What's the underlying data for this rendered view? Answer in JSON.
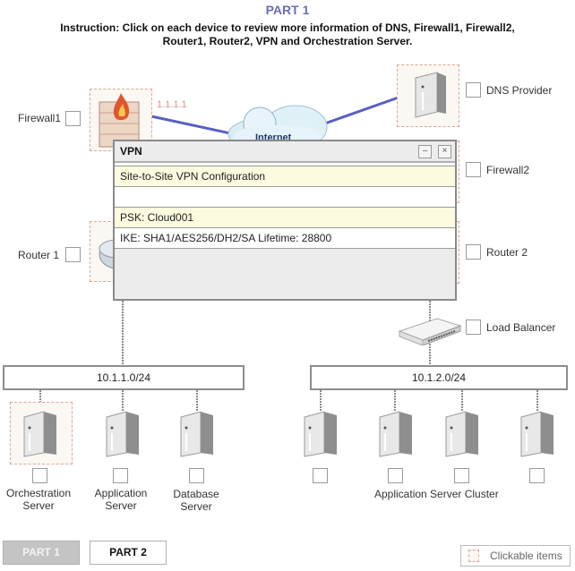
{
  "header": {
    "title": "PART 1",
    "instruction": "Instruction: Click on each device to review more information of DNS, Firewall1, Firewall2, Router1, Router2, VPN and Orchestration Server."
  },
  "devices": {
    "firewall1": {
      "label": "Firewall1",
      "ip": "1.1.1.1"
    },
    "dns": {
      "label": "DNS Provider"
    },
    "internet": {
      "label": "Internet"
    },
    "firewall2": {
      "label": "Firewall2"
    },
    "router1": {
      "label": "Router 1"
    },
    "router2": {
      "label": "Router 2"
    },
    "load_balancer": {
      "label": "Load Balancer"
    }
  },
  "subnets": [
    {
      "label": "10.1.1.0/24"
    },
    {
      "label": "10.1.2.0/24"
    }
  ],
  "servers_left": [
    {
      "label_line1": "Orchestration",
      "label_line2": "Server"
    },
    {
      "label_line1": "Application",
      "label_line2": "Server"
    },
    {
      "label_line1": "Database",
      "label_line2": "Server"
    }
  ],
  "cluster": {
    "label": "Application Server Cluster"
  },
  "dialog": {
    "title": "VPN",
    "minimize": "–",
    "close": "×",
    "rows": [
      "Site-to-Site VPN Configuration",
      "",
      "PSK: Cloud001",
      "IKE: SHA1/AES256/DH2/SA Lifetime: 28800"
    ]
  },
  "footer": {
    "part1": "PART 1",
    "part2": "PART 2",
    "legend": "Clickable items"
  },
  "colors": {
    "title": "#6a6eb5",
    "link_line": "#5a5fc0",
    "clickable_border": "#d7a89a",
    "active_part_bg": "#c4c4c4"
  }
}
